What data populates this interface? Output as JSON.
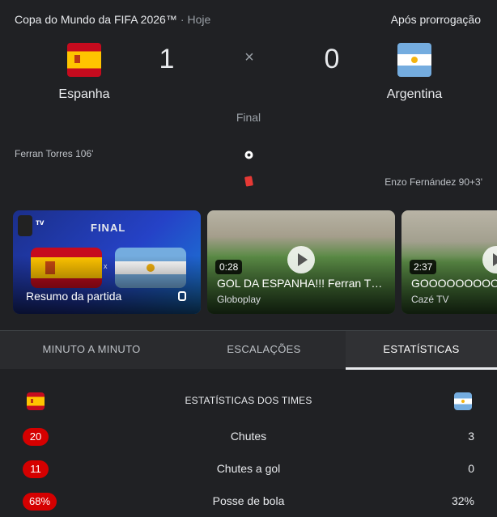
{
  "header": {
    "competition": "Copa do Mundo da FIFA 2026™",
    "separator": "·",
    "when": "Hoje",
    "status": "Após prorrogação"
  },
  "match": {
    "home": {
      "name": "Espanha",
      "score": "1"
    },
    "away": {
      "name": "Argentina",
      "score": "0"
    },
    "vs": "×",
    "state": "Final"
  },
  "events": {
    "home_goal": "Ferran Torres 106'",
    "away_card": "Enzo Fernández 90+3'"
  },
  "videos": [
    {
      "title": "Resumo da partida",
      "banner": "FINAL",
      "vs": "x",
      "duration": "",
      "source": ""
    },
    {
      "title": "GOL DA ESPANHA!!! Ferran T…",
      "duration": "0:28",
      "source": "Globoplay"
    },
    {
      "title": "GOOOOOOOOOO",
      "duration": "2:37",
      "source": "Cazé TV"
    }
  ],
  "tabs": [
    {
      "label": "MINUTO A MINUTO"
    },
    {
      "label": "ESCALAÇÕES"
    },
    {
      "label": "ESTATÍSTICAS"
    }
  ],
  "stats": {
    "title": "ESTATÍSTICAS DOS TIMES",
    "rows": [
      {
        "label": "Chutes",
        "home": "20",
        "away": "3"
      },
      {
        "label": "Chutes a gol",
        "home": "11",
        "away": "0"
      },
      {
        "label": "Posse de bola",
        "home": "68%",
        "away": "32%"
      }
    ]
  },
  "colors": {
    "background": "#202124",
    "accent_red": "#d50000",
    "spain_red": "#c60b1e",
    "spain_yellow": "#ffc400",
    "argentina_blue": "#74acdf"
  },
  "icons": {
    "goal": "soccer-ball-icon",
    "card": "red-card-icon",
    "play": "play-icon"
  }
}
